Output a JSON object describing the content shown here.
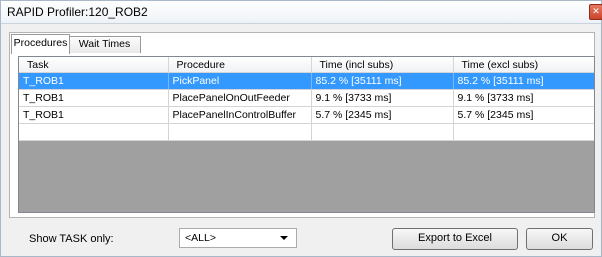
{
  "window": {
    "title": "RAPID Profiler:120_ROB2"
  },
  "tabs": [
    {
      "label": "Procedures",
      "active": true
    },
    {
      "label": "Wait Times",
      "active": false
    }
  ],
  "table": {
    "columns": [
      "Task",
      "Procedure",
      "Time (incl subs)",
      "Time (excl subs)"
    ],
    "rows": [
      {
        "task": "T_ROB1",
        "procedure": "PickPanel",
        "incl": "85.2 %  [35111 ms]",
        "excl": "85.2 %  [35111 ms]",
        "selected": true
      },
      {
        "task": "T_ROB1",
        "procedure": "PlacePanelOnOutFeeder",
        "incl": "9.1 %  [3733 ms]",
        "excl": "9.1 %  [3733 ms]",
        "selected": false
      },
      {
        "task": "T_ROB1",
        "procedure": "PlacePanelInControlBuffer",
        "incl": "5.7 %  [2345 ms]",
        "excl": "5.7 %  [2345 ms]",
        "selected": false
      },
      {
        "task": "",
        "procedure": "",
        "incl": "",
        "excl": "",
        "selected": false
      }
    ]
  },
  "footer": {
    "show_task_label": "Show TASK only:",
    "task_select_value": "<ALL>",
    "export_label": "Export to Excel",
    "ok_label": "OK"
  },
  "colors": {
    "selection": "#3399ff",
    "grid_empty": "#a0a0a0"
  }
}
